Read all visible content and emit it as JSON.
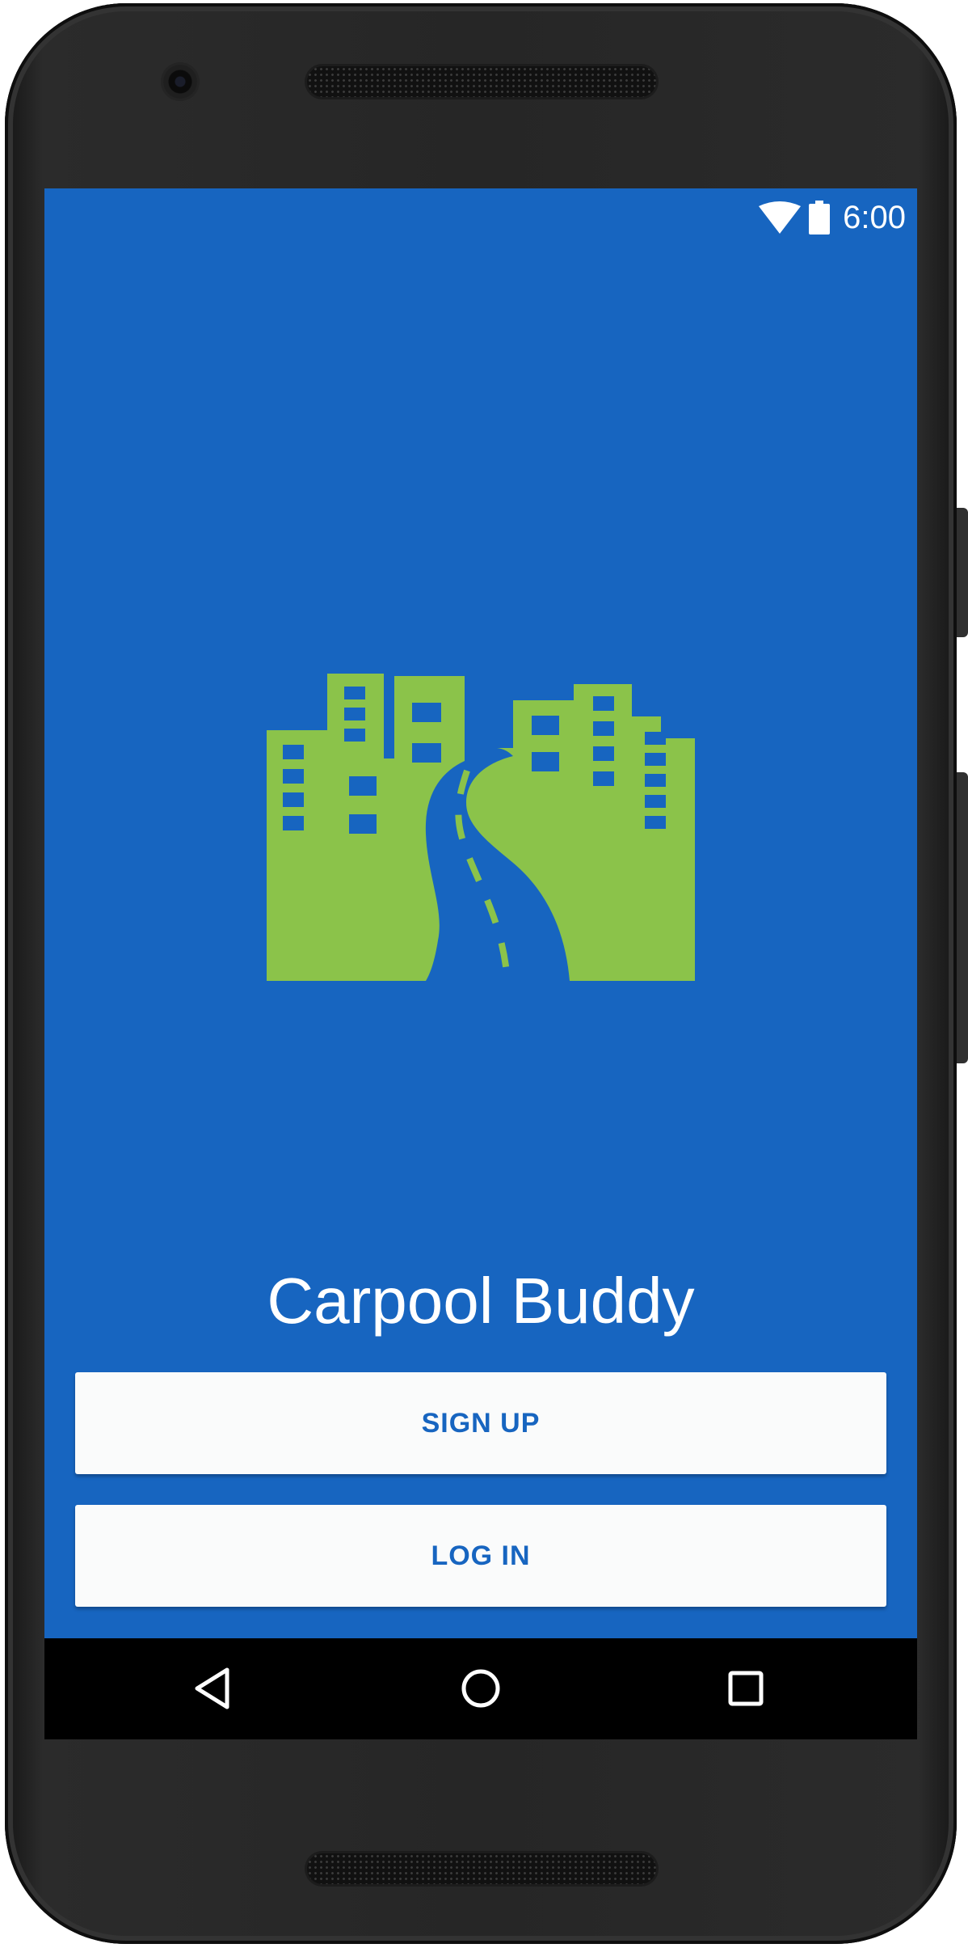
{
  "status_bar": {
    "time": "6:00",
    "icons": [
      "wifi-icon",
      "battery-icon"
    ]
  },
  "app": {
    "logo": "city-road-icon",
    "title": "Carpool Buddy"
  },
  "buttons": {
    "signup_label": "SIGN UP",
    "login_label": "LOG IN"
  },
  "nav_bar": {
    "icons": [
      "back-icon",
      "home-icon",
      "recents-icon"
    ]
  },
  "colors": {
    "screen_background": "#1765c0",
    "logo_green": "#8bc34a",
    "button_background": "#fafbfb",
    "button_text": "#1765c0",
    "nav_bar": "#000000"
  }
}
